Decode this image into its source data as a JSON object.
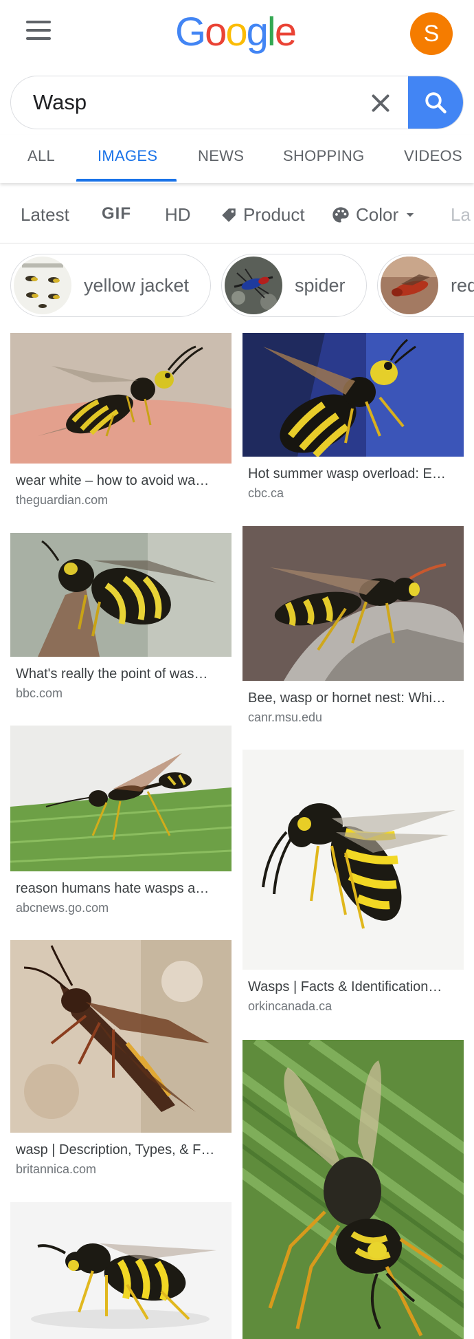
{
  "header": {
    "logo_letters": [
      {
        "char": "G",
        "color": "#4285F4"
      },
      {
        "char": "o",
        "color": "#EA4335"
      },
      {
        "char": "o",
        "color": "#FBBC05"
      },
      {
        "char": "g",
        "color": "#4285F4"
      },
      {
        "char": "l",
        "color": "#34A853"
      },
      {
        "char": "e",
        "color": "#EA4335"
      }
    ],
    "avatar_initial": "S",
    "avatar_color": "#F57C00"
  },
  "search": {
    "query": "Wasp",
    "button_color": "#4285F4"
  },
  "tabs": [
    {
      "label": "ALL"
    },
    {
      "label": "IMAGES",
      "active": true
    },
    {
      "label": "NEWS"
    },
    {
      "label": "SHOPPING"
    },
    {
      "label": "VIDEOS"
    }
  ],
  "filters": [
    {
      "label": "Latest"
    },
    {
      "label": "GIF"
    },
    {
      "label": "HD"
    },
    {
      "label": "Product",
      "icon": "tag-icon"
    },
    {
      "label": "Color",
      "icon": "palette-icon"
    },
    {
      "label": "La"
    }
  ],
  "chips": [
    {
      "label": "yellow jacket"
    },
    {
      "label": "spider"
    },
    {
      "label": "red"
    }
  ],
  "results": [
    {
      "title": "wear white – how to avoid wa…",
      "source": "theguardian.com"
    },
    {
      "title": "Hot summer wasp overload: E…",
      "source": "cbc.ca"
    },
    {
      "title": "What's really the point of was…",
      "source": "bbc.com"
    },
    {
      "title": "Bee, wasp or hornet nest: Whi…",
      "source": "canr.msu.edu"
    },
    {
      "title": "reason humans hate wasps a…",
      "source": "abcnews.go.com"
    },
    {
      "title": "Wasps | Facts & Identification…",
      "source": "orkincanada.ca"
    },
    {
      "title": "wasp | Description, Types, & F…",
      "source": "britannica.com"
    },
    {
      "title": "",
      "source": ""
    },
    {
      "title": "",
      "source": ""
    }
  ]
}
